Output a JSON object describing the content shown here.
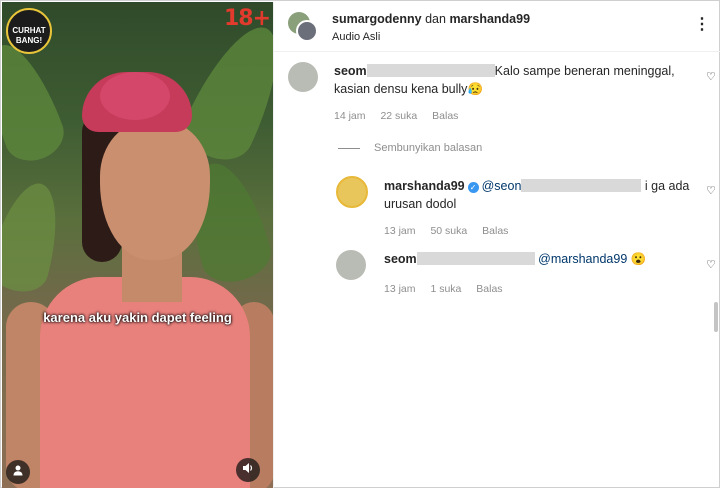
{
  "video": {
    "channel_logo_text": "CURHAT BANG!",
    "rating": "18+",
    "caption": "karena aku yakin dapet feeling",
    "profile_icon": "person-icon",
    "mute_icon": "speaker-icon"
  },
  "header": {
    "user1": "sumargodenny",
    "conjunction": "dan",
    "user2": "marshanda99",
    "audio": "Audio Asli",
    "more": "⋮"
  },
  "comments": [
    {
      "username": "seom",
      "text": "Kalo sampe beneran meninggal, kasian densu kena bully",
      "emoji": "😥",
      "time": "14 jam",
      "likes": "22 suka",
      "reply": "Balas"
    }
  ],
  "hide_replies": "Sembunyikan balasan",
  "replies": [
    {
      "username": "marshanda99",
      "verified": true,
      "mention": "@seon",
      "text_tail": "i ga ada",
      "text_line2": "urusan dodol",
      "time": "13 jam",
      "likes": "50 suka",
      "reply": "Balas"
    },
    {
      "username": "seom",
      "mention": "@marshanda99",
      "emoji": "😮",
      "time": "13 jam",
      "likes": "1 suka",
      "reply": "Balas"
    }
  ],
  "colors": {
    "rating": "#e23a2c",
    "verified": "#3897f0",
    "meta": "#8e8e8e"
  }
}
